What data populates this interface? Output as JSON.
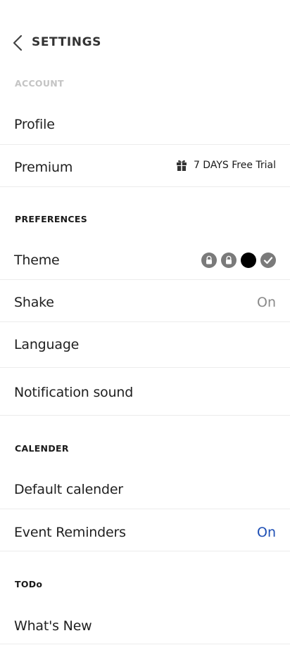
{
  "header": {
    "title": "SETTINGS",
    "back_icon": "chevron-left-icon"
  },
  "sections": {
    "account": {
      "label": "ACCOUNT"
    },
    "preferences": {
      "label": "PREFERENCES"
    },
    "calender": {
      "label": "CALENDER"
    },
    "todo": {
      "label": "TODo"
    }
  },
  "rows": {
    "profile": {
      "label": "Profile"
    },
    "premium": {
      "label": "Premium",
      "trial_text": "7 DAYS Free Trial",
      "icon": "gift-icon"
    },
    "theme": {
      "label": "Theme",
      "swatches": [
        {
          "name": "locked-theme-1",
          "color": "#7a7a7a",
          "state": "locked"
        },
        {
          "name": "locked-theme-2",
          "color": "#7a7a7a",
          "state": "locked"
        },
        {
          "name": "black-theme",
          "color": "#000000",
          "state": "available"
        },
        {
          "name": "selected-theme",
          "color": "#7a7a7a",
          "state": "selected"
        }
      ]
    },
    "shake": {
      "label": "Shake",
      "value": "On",
      "value_color": "#8a8a8a"
    },
    "language": {
      "label": "Language"
    },
    "notification_sound": {
      "label": "Notification sound"
    },
    "default_calender": {
      "label": "Default calender"
    },
    "event_reminders": {
      "label": "Event Reminders",
      "value": "On",
      "value_color": "#1e4fb5"
    },
    "whats_new": {
      "label": "What's New"
    }
  }
}
